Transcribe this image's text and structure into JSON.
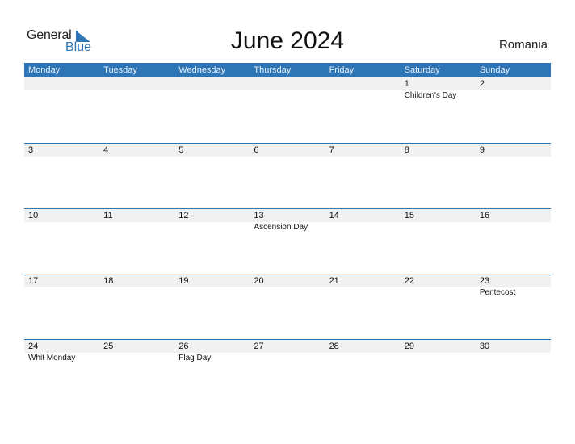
{
  "logo": {
    "line1": "General",
    "line2": "Blue"
  },
  "title": "June 2024",
  "country": "Romania",
  "colors": {
    "accent": "#2e75b6",
    "day_row_bg": "#f1f1f1"
  },
  "weekdays": [
    "Monday",
    "Tuesday",
    "Wednesday",
    "Thursday",
    "Friday",
    "Saturday",
    "Sunday"
  ],
  "weeks": [
    {
      "days": [
        "",
        "",
        "",
        "",
        "",
        "1",
        "2"
      ],
      "events": [
        "",
        "",
        "",
        "",
        "",
        "Children's Day",
        ""
      ]
    },
    {
      "days": [
        "3",
        "4",
        "5",
        "6",
        "7",
        "8",
        "9"
      ],
      "events": [
        "",
        "",
        "",
        "",
        "",
        "",
        ""
      ]
    },
    {
      "days": [
        "10",
        "11",
        "12",
        "13",
        "14",
        "15",
        "16"
      ],
      "events": [
        "",
        "",
        "",
        "Ascension Day",
        "",
        "",
        ""
      ]
    },
    {
      "days": [
        "17",
        "18",
        "19",
        "20",
        "21",
        "22",
        "23"
      ],
      "events": [
        "",
        "",
        "",
        "",
        "",
        "",
        "Pentecost"
      ]
    },
    {
      "days": [
        "24",
        "25",
        "26",
        "27",
        "28",
        "29",
        "30"
      ],
      "events": [
        "Whit Monday",
        "",
        "Flag Day",
        "",
        "",
        "",
        ""
      ]
    }
  ]
}
